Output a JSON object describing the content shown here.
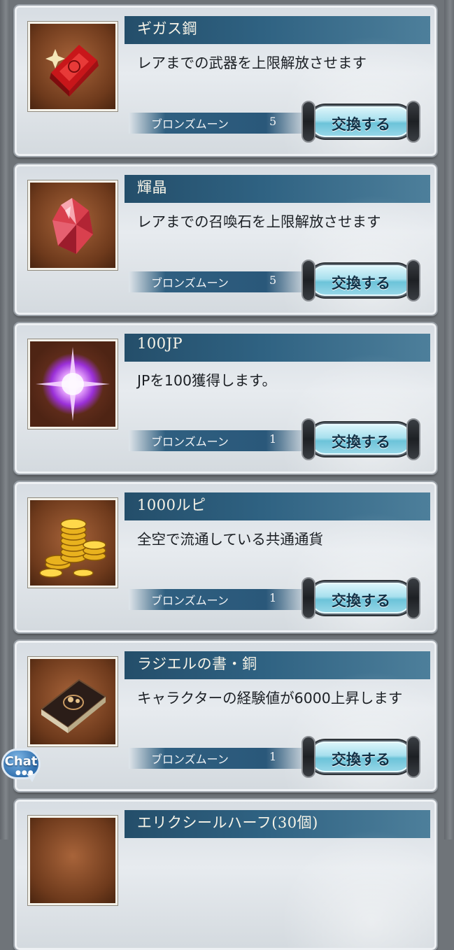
{
  "items": [
    {
      "title": "ギガス鋼",
      "description": "レアまでの武器を上限解放させます",
      "cost_name": "ブロンズムーン",
      "cost_count": "5",
      "button": "交換する",
      "icon": "red-ingot-icon"
    },
    {
      "title": "輝晶",
      "description": "レアまでの召喚石を上限解放させます",
      "cost_name": "ブロンズムーン",
      "cost_count": "5",
      "button": "交換する",
      "icon": "red-crystal-icon"
    },
    {
      "title": "100JP",
      "description": "JPを100獲得します。",
      "cost_name": "ブロンズムーン",
      "cost_count": "1",
      "button": "交換する",
      "icon": "purple-orb-icon"
    },
    {
      "title": "1000ルピ",
      "description": "全空で流通している共通通貨",
      "cost_name": "ブロンズムーン",
      "cost_count": "1",
      "button": "交換する",
      "icon": "gold-coins-icon"
    },
    {
      "title": "ラジエルの書・銅",
      "description": "キャラクターの経験値が6000上昇します",
      "cost_name": "ブロンズムーン",
      "cost_count": "1",
      "button": "交換する",
      "icon": "book-icon"
    },
    {
      "title": "エリクシールハーフ(30個)"
    }
  ],
  "chat": {
    "label": "Chat",
    "icon": "chat-bubble-icon"
  },
  "colors": {
    "title_bar": "#2f6282",
    "button": "#a8e0ee",
    "background": "#6f7479"
  }
}
